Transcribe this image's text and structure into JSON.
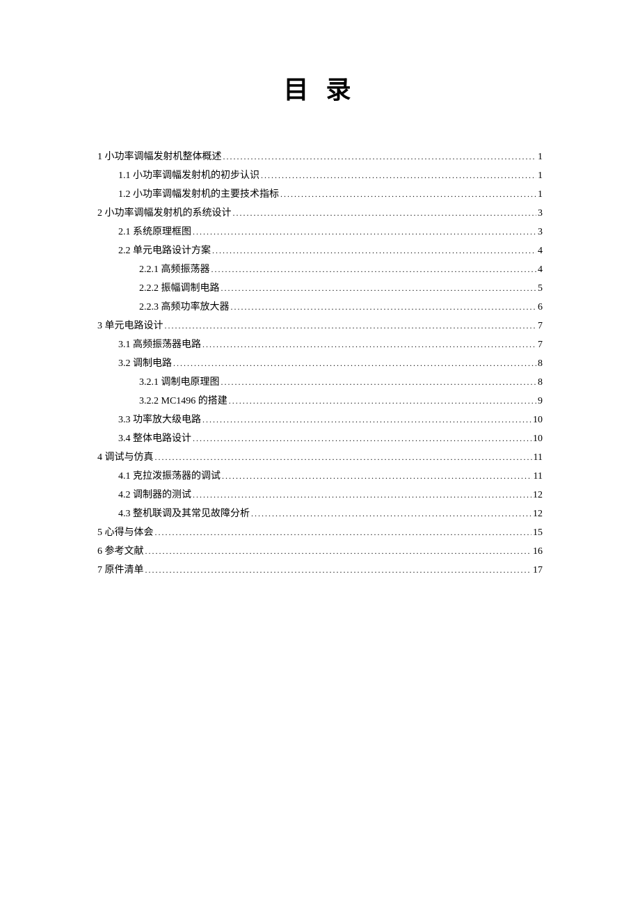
{
  "title": "目 录",
  "toc": [
    {
      "level": 1,
      "label": "1  小功率调幅发射机整体概述",
      "page": "1"
    },
    {
      "level": 2,
      "label": "1.1  小功率调幅发射机的初步认识",
      "page": "1"
    },
    {
      "level": 2,
      "label": "1.2  小功率调幅发射机的主要技术指标",
      "page": "1"
    },
    {
      "level": 1,
      "label": "2  小功率调幅发射机的系统设计",
      "page": "3"
    },
    {
      "level": 2,
      "label": "2.1  系统原理框图",
      "page": "3"
    },
    {
      "level": 2,
      "label": "2.2  单元电路设计方案",
      "page": "4"
    },
    {
      "level": 3,
      "label": "2.2.1  高频振荡器",
      "page": "4"
    },
    {
      "level": 3,
      "label": "2.2.2  振幅调制电路",
      "page": "5"
    },
    {
      "level": 3,
      "label": "2.2.3 高频功率放大器",
      "page": "6"
    },
    {
      "level": 1,
      "label": "3 单元电路设计",
      "page": "7"
    },
    {
      "level": 2,
      "label": "3.1 高频振荡器电路",
      "page": "7"
    },
    {
      "level": 2,
      "label": "3.2  调制电路",
      "page": "8"
    },
    {
      "level": 3,
      "label": "3.2.1  调制电原理图",
      "page": "8"
    },
    {
      "level": 3,
      "label": "3.2.2 MC1496 的搭建 ",
      "page": "9"
    },
    {
      "level": 2,
      "label": "3.3 功率放大级电路",
      "page": "10"
    },
    {
      "level": 2,
      "label": "3.4  整体电路设计",
      "page": "10"
    },
    {
      "level": 1,
      "label": "4  调试与仿真",
      "page": "11"
    },
    {
      "level": 2,
      "label": "4.1 克拉泼振荡器的调试",
      "page": "11"
    },
    {
      "level": 2,
      "label": "4.2 调制器的测试",
      "page": "12"
    },
    {
      "level": 2,
      "label": "4.3 整机联调及其常见故障分析",
      "page": "12"
    },
    {
      "level": 1,
      "label": "5  心得与体会",
      "page": "15"
    },
    {
      "level": 1,
      "label": "6  参考文献",
      "page": "16"
    },
    {
      "level": 1,
      "label": "7  原件清单",
      "page": "17"
    }
  ]
}
